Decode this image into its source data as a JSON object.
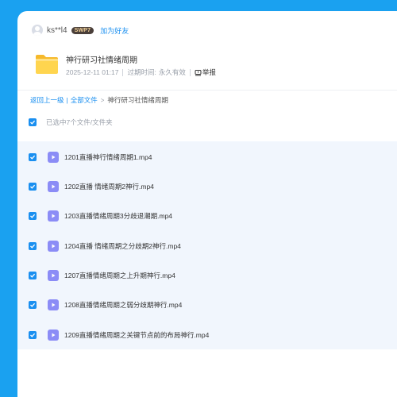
{
  "user": {
    "name": "ks**l4",
    "badge": "SWP7",
    "add_friend": "加为好友"
  },
  "share": {
    "title": "神行研习社情绪周期",
    "date": "2025-12-11 01:17",
    "expiry_label": "过期时间:",
    "expiry_value": "永久有效",
    "report": "举报"
  },
  "breadcrumb": {
    "back": "返回上一级",
    "separator": "|",
    "all_files": "全部文件",
    "arrow": ">",
    "current": "神行研习社情绪周期"
  },
  "selection": {
    "summary": "已选中7个文件/文件夹"
  },
  "files": [
    {
      "name": "1201直播神行情绪周期1.mp4",
      "checked": true
    },
    {
      "name": "1202直播 情绪周期2神行.mp4",
      "checked": true
    },
    {
      "name": "1203直播情绪周期3分歧退潮期.mp4",
      "checked": true
    },
    {
      "name": "1204直播 情绪周期之分歧期2神行.mp4",
      "checked": true
    },
    {
      "name": "1207直播情绪周期之上升期神行.mp4",
      "checked": true
    },
    {
      "name": "1208直播情绪周期之弱分歧期神行.mp4",
      "checked": true
    },
    {
      "name": "1209直播情绪周期之关键节点前的布局神行.mp4",
      "checked": true
    }
  ],
  "colors": {
    "background": "#1aa1f0",
    "accent": "#1a8ff0",
    "video_icon": "#8b8cf6",
    "list_bg": "#f1f6fd"
  }
}
